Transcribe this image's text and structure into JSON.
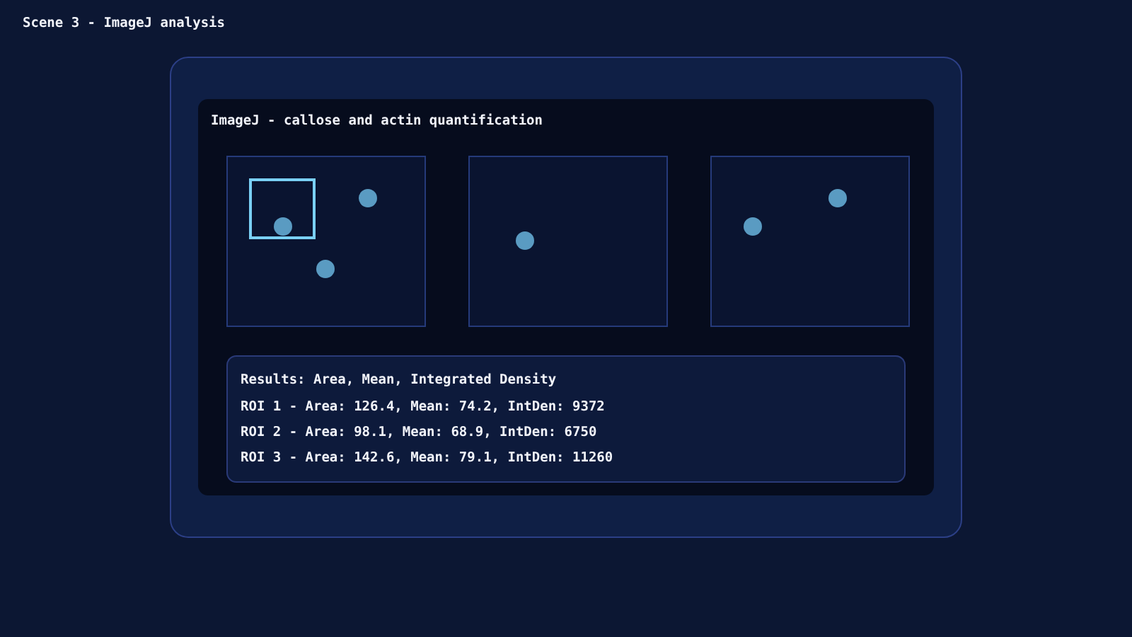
{
  "scene_title": "Scene 3 - ImageJ analysis",
  "window": {
    "title": "ImageJ - callose and actin quantification"
  },
  "images": [
    {
      "kind": "picture",
      "roi": true
    },
    {
      "kind": "picture",
      "roi": false
    },
    {
      "kind": "picture",
      "roi": false
    }
  ],
  "results": {
    "heading": "Results: Area, Mean, Integrated Density",
    "rows": [
      "ROI 1 - Area: 126.4, Mean: 74.2, IntDen: 9372",
      "ROI 2 - Area: 98.1, Mean: 68.9, IntDen: 6750",
      "ROI 3 - Area: 142.6, Mean: 79.1, IntDen: 11260"
    ]
  }
}
